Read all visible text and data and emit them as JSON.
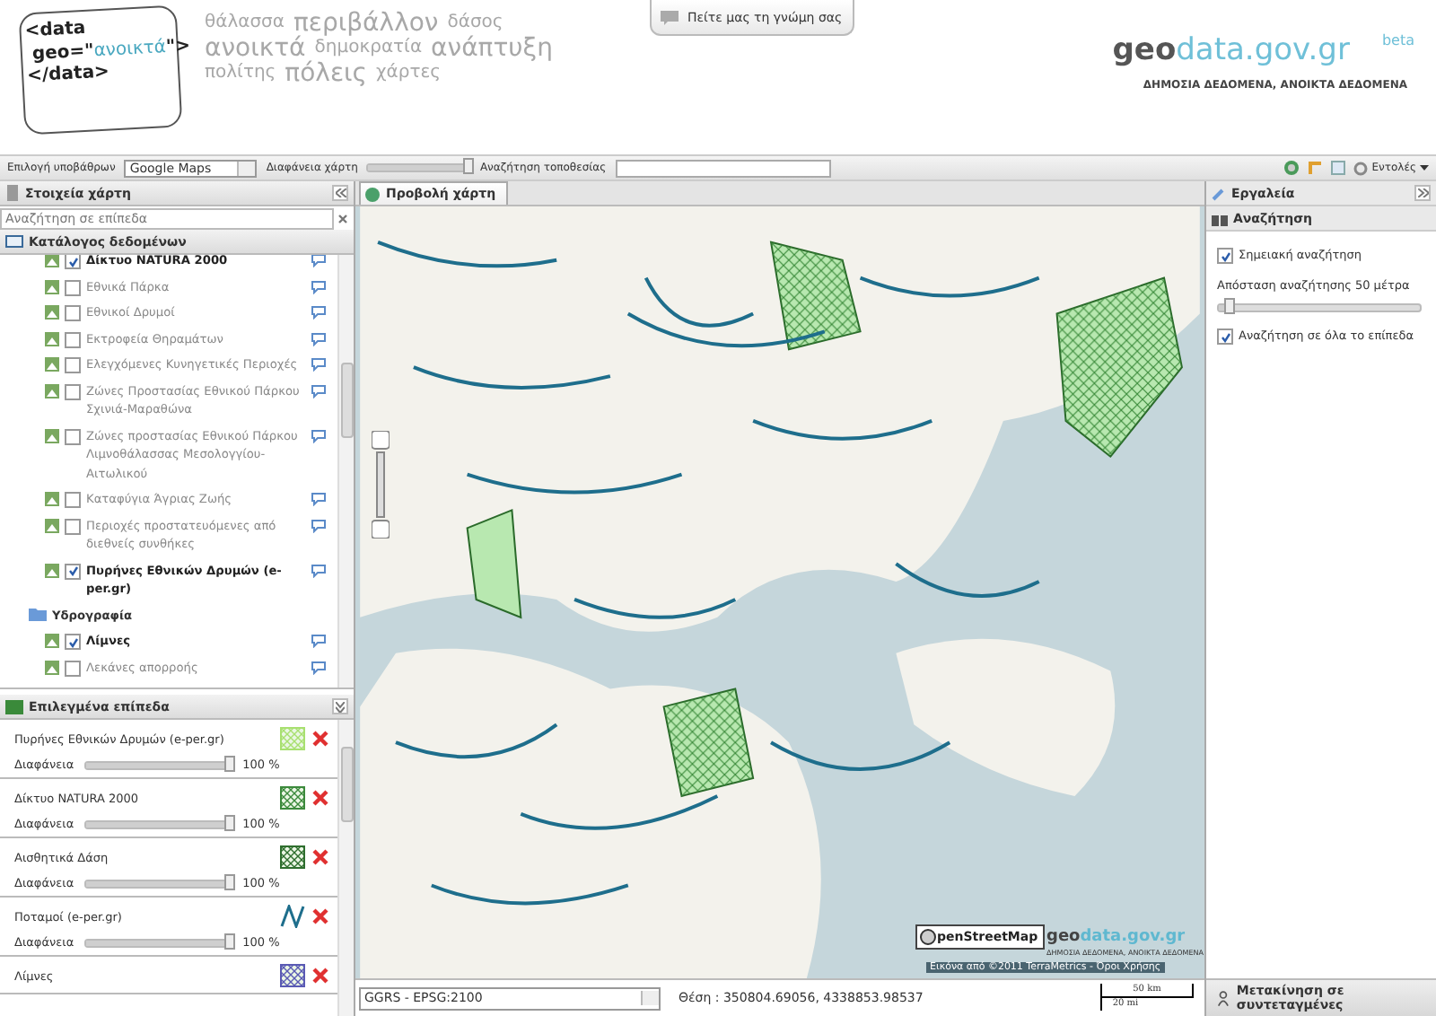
{
  "header": {
    "logo_lines": [
      "<data",
      " geo=\"",
      "ανοικτά",
      "\">",
      "</data>"
    ],
    "word_cloud": [
      "θάλασσα",
      "περιβάλλον",
      "δάσος",
      "ανοικτά",
      "δημοκρατία",
      "ανάπτυξη",
      "πολίτης",
      "πόλεις",
      "χάρτες"
    ],
    "feedback_button": "Πείτε μας τη γνώμη σας",
    "site_name_a": "geo",
    "site_name_b": "data.gov.gr",
    "beta": "beta",
    "tagline": "ΔΗΜΟΣΙΑ ΔΕΔΟΜΕΝΑ, ΑΝΟΙΚΤΑ ΔΕΔΟΜΕΝΑ"
  },
  "toolbar": {
    "basemap_label": "Επιλογή υποβάθρων",
    "basemap_value": "Google Maps",
    "opacity": {
      "label": "Διαφάνεια χάρτη",
      "level": 1.0
    },
    "location_label": "Αναζήτηση τοποθεσίας",
    "commands": "Εντολές"
  },
  "left_panel": {
    "title": "Στοιχεία χάρτη",
    "search_placeholder": "Αναζήτηση σε επίπεδα",
    "catalog_title": "Κατάλογος δεδομένων",
    "tree": [
      {
        "kind": "layer",
        "label": "Δίκτυο NATURA 2000",
        "checked": true
      },
      {
        "kind": "layer",
        "label": "Εθνικά Πάρκα",
        "checked": false
      },
      {
        "kind": "layer",
        "label": "Εθνικοί Δρυμοί",
        "checked": false
      },
      {
        "kind": "layer",
        "label": "Εκτροφεία Θηραμάτων",
        "checked": false
      },
      {
        "kind": "layer",
        "label": "Ελεγχόμενες Κυνηγετικές Περιοχές",
        "checked": false
      },
      {
        "kind": "layer",
        "label": "Ζώνες Προστασίας Εθνικού Πάρκου Σχινιά-Μαραθώνα",
        "checked": false
      },
      {
        "kind": "layer",
        "label": "Ζώνες προστασίας Εθνικού Πάρκου Λιμνοθάλασσας Μεσολογγίου-Αιτωλικού",
        "checked": false
      },
      {
        "kind": "layer",
        "label": "Καταφύγια Άγριας Ζωής",
        "checked": false
      },
      {
        "kind": "layer",
        "label": "Περιοχές προστατευόμενες από διεθνείς συνθήκες",
        "checked": false
      },
      {
        "kind": "layer",
        "label": "Πυρήνες Εθνικών Δρυμών (e-per.gr)",
        "checked": true
      },
      {
        "kind": "folder",
        "label": "Υδρογραφία",
        "children": [
          {
            "kind": "layer",
            "label": "Λίμνες",
            "checked": true
          },
          {
            "kind": "layer",
            "label": "Λεκάνες απορροής",
            "checked": false
          }
        ]
      }
    ],
    "selected_title": "Επιλεγμένα επίπεδα",
    "selected_layers": [
      {
        "name": "Πυρήνες Εθνικών Δρυμών (e-per.gr)",
        "kind": "fill",
        "color": "#a8e070",
        "opacity_label": "Διαφάνεια",
        "level": 1.0,
        "reading": "100 %"
      },
      {
        "name": "Δίκτυο NATURA 2000",
        "kind": "fill",
        "color": "#3c8a3c",
        "opacity_label": "Διαφάνεια",
        "level": 1.0,
        "reading": "100 %"
      },
      {
        "name": "Αισθητικά Δάση",
        "kind": "fill",
        "color": "#2e6e2e",
        "opacity_label": "Διαφάνεια",
        "level": 1.0,
        "reading": "100 %"
      },
      {
        "name": "Ποταμοί (e-per.gr)",
        "kind": "line",
        "color": "#1e6e8c",
        "opacity_label": "Διαφάνεια",
        "level": 1.0,
        "reading": "100 %"
      },
      {
        "name": "Λίμνες",
        "kind": "fill",
        "color": "#5a5ab4"
      }
    ]
  },
  "map": {
    "tab": "Προβολή χάρτη",
    "logo_a": "geo",
    "logo_b": "data.gov.gr",
    "logo_sub": "ΔΗΜΟΣΙΑ ΔΕΔΟΜΕΝΑ, ΑΝΟΙΚΤΑ ΔΕΔΟΜΕΝΑ",
    "osm_logo": "penStreetMap",
    "attribution": "Εικόνα από ©2011 TerraMetrics - ",
    "terms_link": "Όροι Χρήσης",
    "scale_km": "50 km",
    "scale_mi": "20 mi"
  },
  "status_bar": {
    "projection": "GGRS - EPSG:2100",
    "position": "Θέση : 350804.69056, 4338853.98537"
  },
  "right_panel": {
    "title": "Εργαλεία",
    "section": "Αναζήτηση",
    "point_search": {
      "label": "Σημειακή αναζήτηση",
      "checked": true
    },
    "distance": {
      "label": "Απόσταση αναζήτησης 50 μέτρα",
      "level": 0.05
    },
    "all_layers": {
      "label": "Αναζήτηση σε όλα το επίπεδα",
      "checked": true
    },
    "move_button": "Μετακίνηση σε συντεταγμένες"
  }
}
